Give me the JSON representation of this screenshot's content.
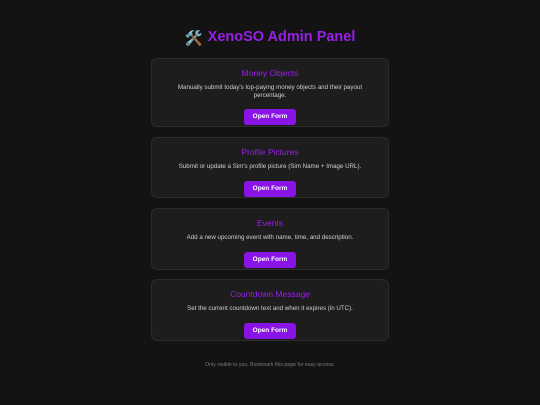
{
  "header": {
    "title": "XenoSO Admin Panel",
    "icon": "hammer-and-wrench-icon",
    "icon_glyph": "🛠️"
  },
  "cards": [
    {
      "title": "Money Objects",
      "description": "Manually submit today's top-paying money objects and their payout percentage.",
      "button_label": "Open Form"
    },
    {
      "title": "Profile Pictures",
      "description": "Submit or update a Sim's profile picture (Sim Name + Image URL).",
      "button_label": "Open Form"
    },
    {
      "title": "Events",
      "description": "Add a new upcoming event with name, time, and description.",
      "button_label": "Open Form"
    },
    {
      "title": "Countdown Message",
      "description": "Set the current countdown text and when it expires (in UTC).",
      "button_label": "Open Form"
    }
  ],
  "footer": {
    "text": "Only visible to you. Bookmark this page for easy access."
  },
  "colors": {
    "background": "#131313",
    "card": "#1d1d1d",
    "accent": "#9a1fe8",
    "button": "#8a14e6"
  }
}
